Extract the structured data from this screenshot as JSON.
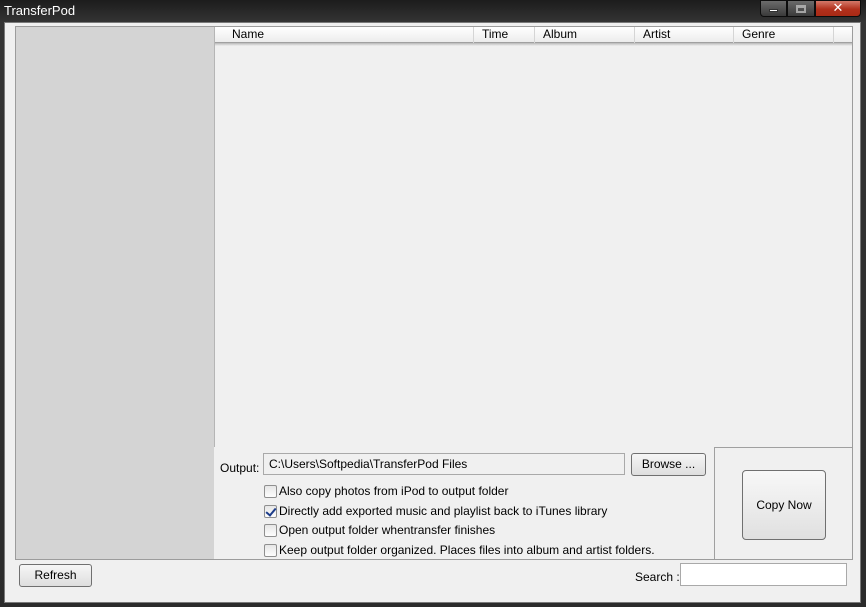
{
  "window": {
    "title": "TransferPod",
    "controls": {
      "minimize": "minimize",
      "maximize": "maximize",
      "close": "✕"
    }
  },
  "list": {
    "columns": [
      "Name",
      "Time",
      "Album",
      "Artist",
      "Genre"
    ],
    "rows": []
  },
  "output": {
    "label": "Output:",
    "path": "C:\\Users\\Softpedia\\TransferPod Files",
    "browse_label": "Browse ..."
  },
  "options": [
    {
      "label": "Also copy photos from iPod to output folder",
      "checked": false
    },
    {
      "label": "Directly add exported music and playlist back to iTunes library",
      "checked": true
    },
    {
      "label": "Open output folder whentransfer finishes",
      "checked": false
    },
    {
      "label": "Keep output folder organized. Places files into album and artist folders.",
      "checked": false
    }
  ],
  "copy_label": "Copy Now",
  "bottom": {
    "refresh_label": "Refresh",
    "search_label": "Search :",
    "search_value": ""
  },
  "colors": {
    "close_button": "#b2301c",
    "left_panel": "#d4d4d4",
    "client_bg": "#f0f0f0"
  }
}
